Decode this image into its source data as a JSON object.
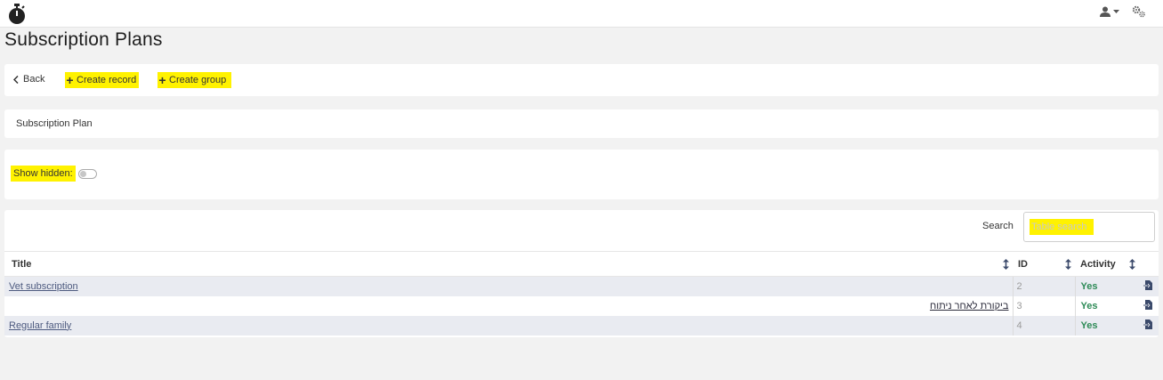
{
  "page": {
    "title": "Subscription Plans"
  },
  "header": {
    "logo_icon": "stopwatch-icon",
    "user_icon": "user-icon",
    "settings_icon": "gears-icon"
  },
  "actions": {
    "back_label": "Back",
    "create_record_label": "Create record",
    "create_group_label": "Create group"
  },
  "plan": {
    "label": "Subscription Plan"
  },
  "filters": {
    "show_hidden_label": "Show hidden:",
    "show_hidden_value": false
  },
  "search": {
    "label": "Search",
    "placeholder": "Table search",
    "value": ""
  },
  "table": {
    "columns": [
      "Title",
      "ID",
      "Activity"
    ],
    "rows": [
      {
        "title": "Vet subscription",
        "id": "2",
        "activity": "Yes"
      },
      {
        "title": "ביקורת לאחר ניתוח",
        "id": "3",
        "activity": "Yes"
      },
      {
        "title": "Regular family",
        "id": "4",
        "activity": "Yes"
      }
    ]
  },
  "colors": {
    "highlight": "#fff200",
    "active_green": "#2e8b57",
    "row_alt": "#e9ebf1",
    "link": "#4d5a7f"
  }
}
